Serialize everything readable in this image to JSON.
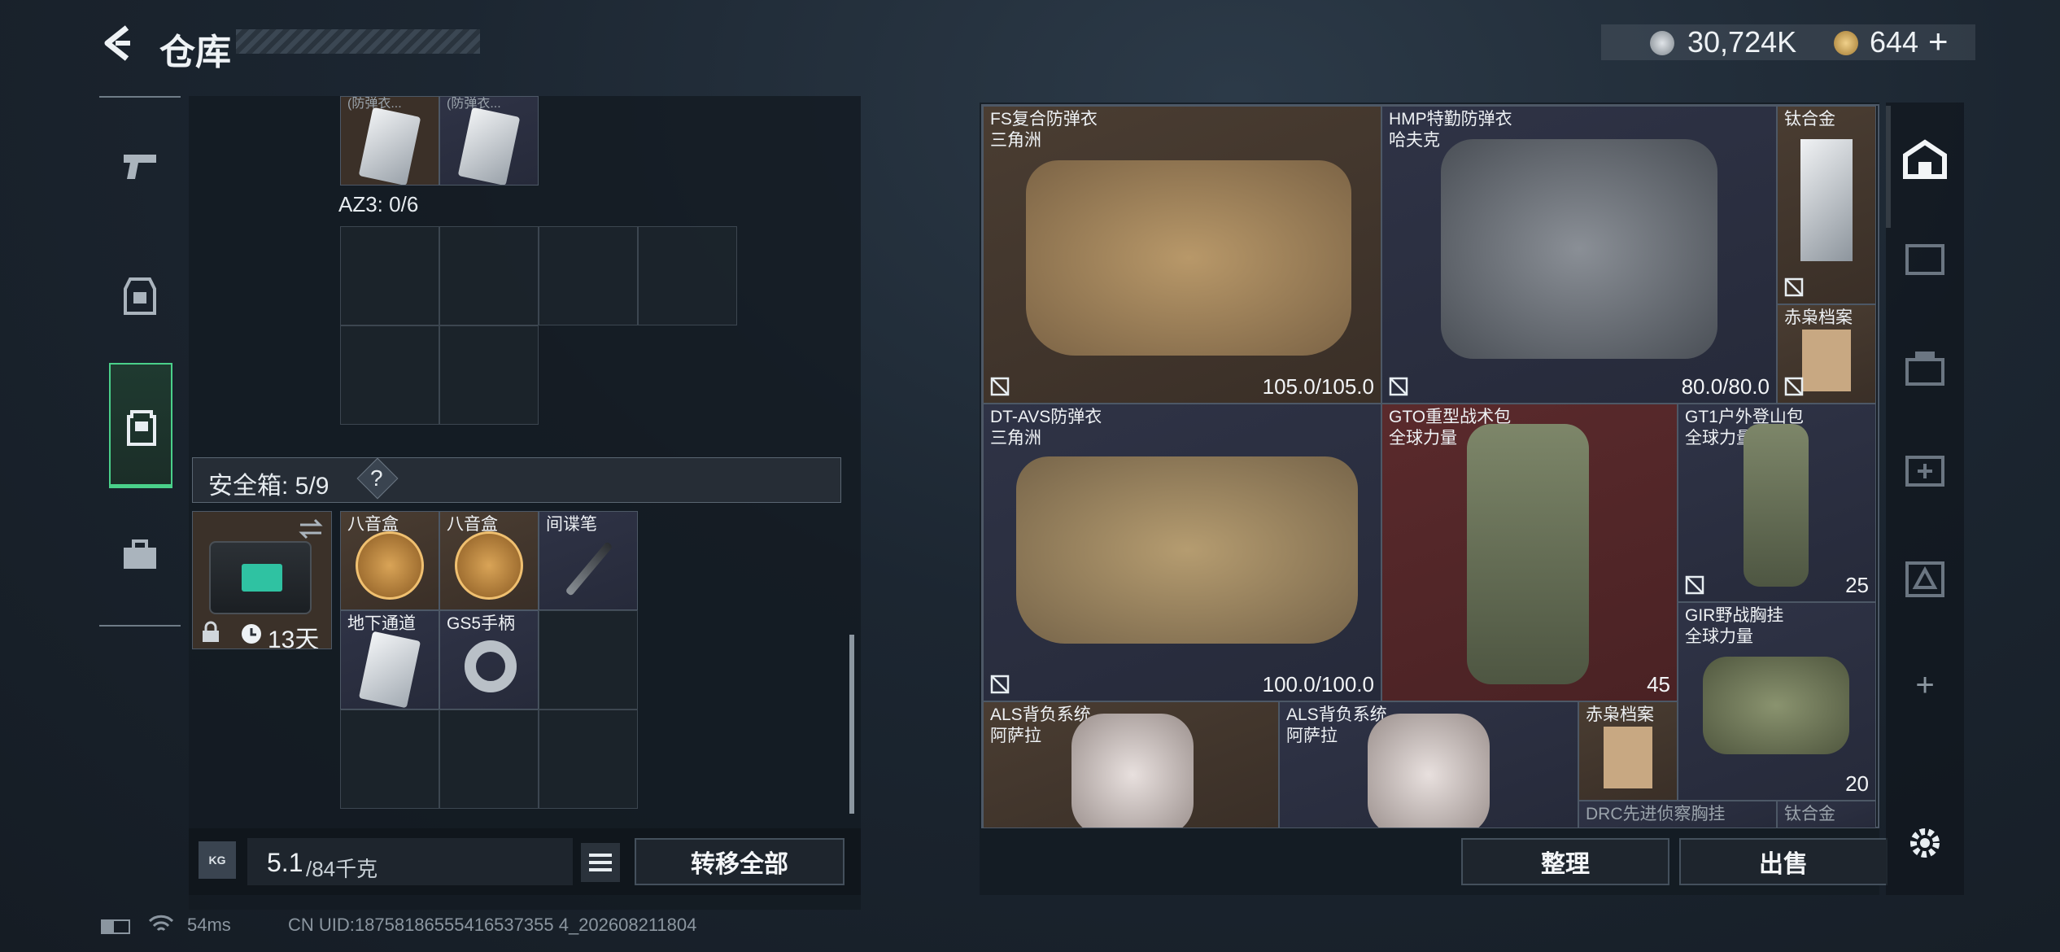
{
  "header": {
    "title": "仓库"
  },
  "currency": {
    "coins": "30,724K",
    "gold": "644"
  },
  "left_panel": {
    "top_items": [
      "(防弹衣...",
      "(防弹衣..."
    ],
    "az3_label": "AZ3: 0/6",
    "safebox": {
      "label": "安全箱: 5/9",
      "help": "?",
      "days": "13天"
    },
    "safebox_items": [
      {
        "name": "八音盒"
      },
      {
        "name": "八音盒"
      },
      {
        "name": "间谍笔"
      },
      {
        "name": "地下通道"
      },
      {
        "name": "GS5手柄"
      }
    ],
    "weight": {
      "current": "5.1",
      "max": "/84千克"
    },
    "transfer_all": "转移全部"
  },
  "right_panel": {
    "items": [
      {
        "name": "FS复合防弹衣",
        "sub": "三角洲",
        "value": "105.0/105.0"
      },
      {
        "name": "HMP特勤防弹衣",
        "sub": "哈夫克",
        "value": "80.0/80.0"
      },
      {
        "name": "钛合金",
        "sub": ""
      },
      {
        "name": "赤枭档案",
        "sub": ""
      },
      {
        "name": "DT-AVS防弹衣",
        "sub": "三角洲",
        "value": "100.0/100.0"
      },
      {
        "name": "GTO重型战术包",
        "sub": "全球力量",
        "value": "45"
      },
      {
        "name": "GT1户外登山包",
        "sub": "全球力量",
        "value": "25"
      },
      {
        "name": "GIR野战胸挂",
        "sub": "全球力量",
        "value": "20"
      },
      {
        "name": "ALS背负系统",
        "sub": "阿萨拉"
      },
      {
        "name": "ALS背负系统",
        "sub": "阿萨拉"
      },
      {
        "name": "赤枭档案",
        "sub": ""
      },
      {
        "name": "DRC先进侦察胸挂",
        "sub": ""
      },
      {
        "name": "钛合金",
        "sub": ""
      }
    ],
    "sort_button": "整理",
    "sell_button": "出售"
  },
  "footer": {
    "ping": "54ms",
    "uid": "CN UID:18758186555416537355 4_202608211804"
  },
  "colors": {
    "accent_green": "#4ad08a",
    "panel_bg": "#141b22"
  }
}
